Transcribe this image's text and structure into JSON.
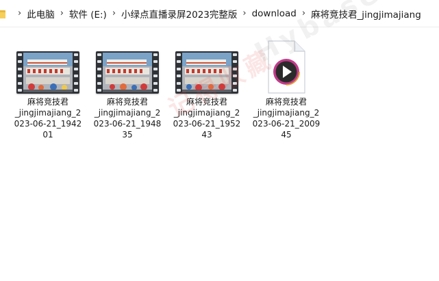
{
  "breadcrumb": {
    "items": [
      "此电脑",
      "软件 (E:)",
      "小绿点直播录屏2023完整版",
      "download",
      "麻将竞技君_jingjimajiang"
    ],
    "separator": "›"
  },
  "files": [
    {
      "type": "video",
      "name_lines": [
        "麻将竞技君",
        "_jingjimajiang_2",
        "023-06-21_1942",
        "01"
      ]
    },
    {
      "type": "video",
      "name_lines": [
        "麻将竞技君",
        "_jingjimajiang_2",
        "023-06-21_1948",
        "35"
      ]
    },
    {
      "type": "video",
      "name_lines": [
        "麻将竞技君",
        "_jingjimajiang_2",
        "023-06-21_1952",
        "43"
      ]
    },
    {
      "type": "media-file",
      "name_lines": [
        "麻将竞技君",
        "_jingjimajiang_2",
        "023-06-21_2009",
        "45"
      ]
    }
  ],
  "watermark": {
    "cn": "记得收藏",
    "en": "Hybase.com"
  },
  "colors": {
    "folder": "#f6cf5a",
    "filmstrip": "#2f3236",
    "play_ring": "#c13b8a",
    "play_button": "#2b2b2b"
  },
  "icons": {
    "folder": "folder-icon",
    "separator": "chevron-right-icon",
    "video": "video-thumbnail-icon",
    "media": "media-file-icon"
  }
}
